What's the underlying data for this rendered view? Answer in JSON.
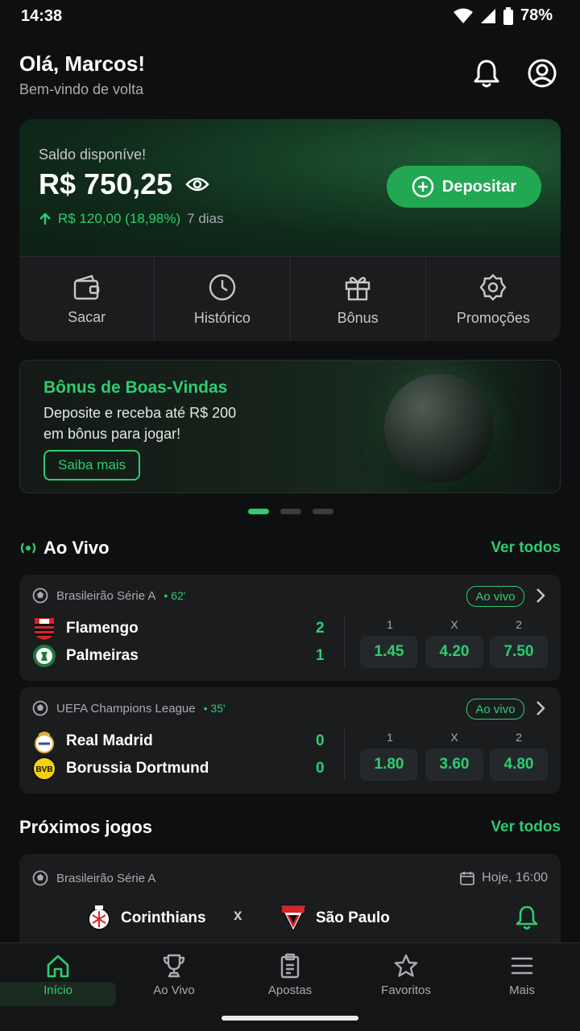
{
  "status_bar": {
    "time": "14:38",
    "battery": "78%"
  },
  "header": {
    "greeting": "Olá, Marcos!",
    "subtitle": "Bem-vindo de volta"
  },
  "balance": {
    "label": "Saldo disponíve!",
    "value": "R$ 750,25",
    "change": "R$ 120,00 (18,98%)",
    "period": "7 dias",
    "deposit_label": "Depositar"
  },
  "quick_actions": [
    {
      "label": "Sacar",
      "icon": "wallet-icon"
    },
    {
      "label": "Histórico",
      "icon": "clock-icon"
    },
    {
      "label": "Bônus",
      "icon": "gift-icon"
    },
    {
      "label": "Promoções",
      "icon": "settings-badge-icon"
    }
  ],
  "promo": {
    "title": "Bônus de Boas-Vindas",
    "line1": "Deposite e receba até R$ 200",
    "line2": "em bônus para jogar!",
    "button": "Saiba mais",
    "slides_total": 3,
    "slide_active": 1
  },
  "live_section": {
    "title": "Ao Vivo",
    "link": "Ver todos"
  },
  "live_matches": [
    {
      "league": "Brasileirão Série A",
      "minute": "• 62'",
      "badge": "Ao vivo",
      "home": "Flamengo",
      "home_score": "2",
      "away": "Palmeiras",
      "away_score": "1",
      "odds_labels": [
        "1",
        "X",
        "2"
      ],
      "odds": [
        "1.45",
        "4.20",
        "7.50"
      ]
    },
    {
      "league": "UEFA Champions League",
      "minute": "• 35'",
      "badge": "Ao vivo",
      "home": "Real Madrid",
      "home_score": "0",
      "away": "Borussia Dortmund",
      "away_score": "0",
      "odds_labels": [
        "1",
        "X",
        "2"
      ],
      "odds": [
        "1.80",
        "3.60",
        "4.80"
      ]
    }
  ],
  "upcoming_section": {
    "title": "Próximos jogos",
    "link": "Ver todos"
  },
  "upcoming_match": {
    "league": "Brasileirão Série A",
    "time": "Hoje, 16:00",
    "home": "Corinthians",
    "vs": "x",
    "away": "São Paulo"
  },
  "bottom_nav": [
    {
      "label": "Início",
      "icon": "home-icon",
      "active": true
    },
    {
      "label": "Ao Vivo",
      "icon": "trophy-icon",
      "active": false
    },
    {
      "label": "Apostas",
      "icon": "clipboard-icon",
      "active": false
    },
    {
      "label": "Favoritos",
      "icon": "star-icon",
      "active": false
    },
    {
      "label": "Mais",
      "icon": "menu-icon",
      "active": false
    }
  ],
  "colors": {
    "accent": "#2ecc71",
    "background": "#0e0f10",
    "card": "#1a1c1e"
  }
}
